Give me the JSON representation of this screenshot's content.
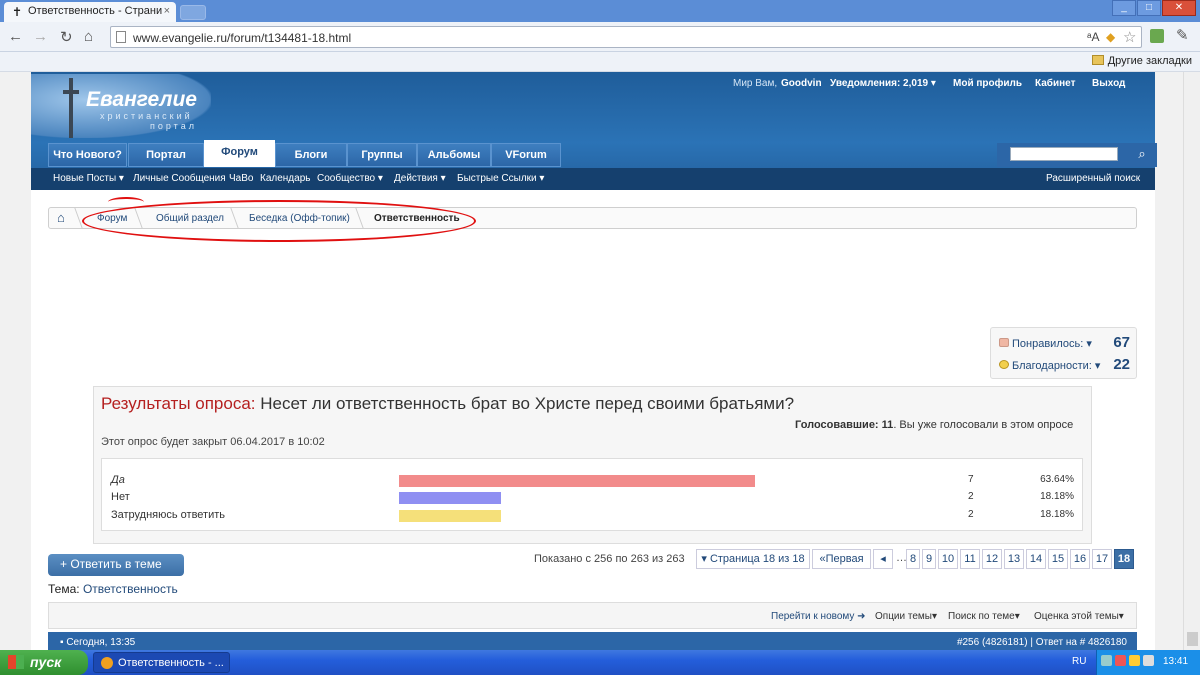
{
  "browser": {
    "tab_title": "Ответственность - Страни",
    "url": "www.evangelie.ru/forum/t134481-18.html",
    "bookmarks_other": "Другие закладки"
  },
  "site": {
    "logo_title": "Евангелие",
    "logo_sub1": "христианский",
    "logo_sub2": "портал",
    "user_greeting": "Мир Вам,",
    "username": "Goodvin",
    "notifications": "Уведомления: 2,019",
    "my_profile": "Мой профиль",
    "cabinet": "Кабинет",
    "logout": "Выход",
    "nav_tabs": [
      "Что Нового?",
      "Портал",
      "Форум",
      "Блоги",
      "Группы",
      "Альбомы",
      "VForum"
    ],
    "active_tab": "Форум",
    "subnav": [
      "Новые Посты",
      "Личные Сообщения",
      "ЧаВо",
      "Календарь",
      "Сообщество",
      "Действия",
      "Быстрые Ссылки"
    ],
    "advanced_search": "Расширенный поиск"
  },
  "breadcrumb": [
    "Форум",
    "Общий раздел",
    "Беседка (Офф-топик)",
    "Ответственность"
  ],
  "likes": {
    "liked_label": "Понравилось:",
    "liked_count": "67",
    "thanks_label": "Благодарности:",
    "thanks_count": "22"
  },
  "poll": {
    "results_label": "Результаты опроса:",
    "question": "Несет ли ответственность брат во Христе перед своими братьями?",
    "voters_label": "Голосовавшие:",
    "voters_count": "11",
    "voted_note": ". Вы уже голосовали в этом опросе",
    "closes": "Этот опрос будет закрыт 06.04.2017 в 10:02",
    "options": [
      {
        "label": "Да",
        "votes": "7",
        "percent": "63.64%",
        "fraction": 0.6364,
        "color": "#f28b8b"
      },
      {
        "label": "Нет",
        "votes": "2",
        "percent": "18.18%",
        "fraction": 0.1818,
        "color": "#8f8ff2"
      },
      {
        "label": "Затрудняюсь ответить",
        "votes": "2",
        "percent": "18.18%",
        "fraction": 0.1818,
        "color": "#f5e07a"
      }
    ]
  },
  "thread": {
    "reply_button": "+ Ответить в теме",
    "shown": "Показано с 256 по 263 из 263",
    "page_label": "Страница 18 из 18",
    "first_label": "Первая",
    "pages": [
      "8",
      "9",
      "10",
      "11",
      "12",
      "13",
      "14",
      "15",
      "16",
      "17",
      "18"
    ],
    "current_page": "18",
    "topic_label": "Тема:",
    "topic": "Ответственность",
    "goto_new": "Перейти к новому",
    "options": "Опции темы",
    "search_thread": "Поиск по теме",
    "rate": "Оценка этой темы",
    "post_time": "Сегодня, 13:35",
    "post_ref": "#256 (4826181) | Ответ на # 4826180"
  },
  "taskbar": {
    "start": "пуск",
    "window": "Ответственность - ...",
    "lang": "RU",
    "clock": "13:41"
  }
}
